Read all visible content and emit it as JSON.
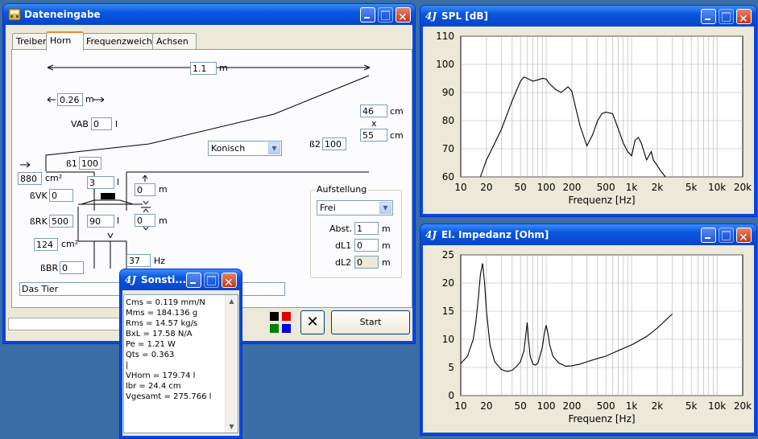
{
  "dateneingabe": {
    "title": "Dateneingabe",
    "tabs": [
      "Treiber",
      "Horn",
      "Frequenzweiche",
      "Achsen"
    ],
    "active_tab": "Horn",
    "fields": {
      "length": "1.1",
      "length_unit": "m",
      "small_len": "0.26",
      "small_len_unit": "m",
      "vab_label": "VAB",
      "vab": "0",
      "vab_unit": "l",
      "width": "46",
      "width_unit": "cm",
      "times": "x",
      "height": "55",
      "height_unit": "cm",
      "beta2_label": "ß2",
      "beta2": "100",
      "beta1_label": "ß1",
      "beta1": "100",
      "flare_type": "Konisch",
      "throat_area": "880",
      "throat_area_unit": "cm²",
      "vol1": "3",
      "vol1_unit": "l",
      "bvk_label": "ßVK",
      "bvk": "0",
      "brk_label": "ßRK",
      "brk": "500",
      "vol2": "90",
      "vol2_unit": "l",
      "dist1": "0",
      "dist1_unit": "m",
      "dist2": "0",
      "dist2_unit": "m",
      "port_area": "124",
      "port_area_unit": "cm²",
      "bbr_label": "ßBR",
      "bbr": "0",
      "freq": "37",
      "freq_unit": "Hz",
      "name": "Das Tier"
    },
    "aufstellung": {
      "label": "Aufstellung",
      "mode": "Frei",
      "abst_label": "Abst.",
      "abst": "1",
      "abst_unit": "m",
      "dl1_label": "dL1",
      "dl1": "0",
      "dl1_unit": "m",
      "dl2_label": "dL2",
      "dl2": "0",
      "dl2_unit": "m"
    },
    "start_label": "Start",
    "swatch_colors": [
      "#000000",
      "#e00000",
      "#008000",
      "#0000e0"
    ]
  },
  "sonstiges": {
    "title": "Sonsti...",
    "lines": [
      "Cms = 0.119 mm/N",
      "Mms = 184.136 g",
      "Rms = 14.57 kg/s",
      "BxL = 17.58 N/A",
      "Pe = 1.21 W",
      "Qts = 0.363",
      "|",
      "VHorn = 179.74 l",
      "lbr = 24.4 cm",
      "Vgesamt = 275.766 l"
    ]
  },
  "chart_data": [
    {
      "type": "line",
      "title": "SPL [dB]",
      "xlabel": "Frequenz [Hz]",
      "ylabel": "",
      "xscale": "log",
      "xlim": [
        10,
        20000
      ],
      "ylim": [
        60,
        110
      ],
      "x_ticks": [
        10,
        20,
        50,
        100,
        200,
        500,
        1000,
        2000,
        5000,
        10000,
        20000
      ],
      "x_tick_labels": [
        "10",
        "20",
        "50",
        "100",
        "200",
        "500",
        "1k",
        "2k",
        "5k",
        "10k",
        "20k"
      ],
      "y_ticks": [
        60,
        70,
        80,
        90,
        100,
        110
      ],
      "grid": true,
      "series": [
        {
          "x": [
            17,
            20,
            25,
            30,
            40,
            50,
            55,
            60,
            70,
            80,
            90,
            100,
            110,
            130,
            150,
            180,
            200,
            220,
            250,
            300,
            350,
            400,
            450,
            500,
            600,
            700,
            800,
            900,
            1000,
            1100,
            1200,
            1300,
            1500,
            1700,
            1800,
            2000,
            2200,
            2500
          ],
          "y": [
            60,
            66,
            72,
            77,
            87,
            94,
            95.5,
            95,
            94,
            94.5,
            95,
            94.8,
            93,
            91,
            90,
            92,
            90.5,
            85,
            78,
            71,
            75,
            80,
            82.5,
            83,
            82.5,
            77,
            72,
            69,
            67.5,
            73,
            74,
            72,
            66,
            69,
            66,
            64,
            62,
            60
          ]
        }
      ]
    },
    {
      "type": "line",
      "title": "El. Impedanz [Ohm]",
      "xlabel": "Frequenz [Hz]",
      "ylabel": "",
      "xscale": "log",
      "xlim": [
        10,
        20000
      ],
      "ylim": [
        0,
        25
      ],
      "x_ticks": [
        10,
        20,
        50,
        100,
        200,
        500,
        1000,
        2000,
        5000,
        10000,
        20000
      ],
      "x_tick_labels": [
        "10",
        "20",
        "50",
        "100",
        "200",
        "500",
        "1k",
        "2k",
        "5k",
        "10k",
        "20k"
      ],
      "y_ticks": [
        0,
        5,
        10,
        15,
        20,
        25
      ],
      "grid": true,
      "series": [
        {
          "x": [
            10,
            12,
            14,
            15,
            16,
            17,
            18,
            19,
            20,
            22,
            25,
            30,
            35,
            40,
            45,
            50,
            55,
            58,
            60,
            62,
            65,
            70,
            75,
            80,
            90,
            95,
            100,
            105,
            110,
            120,
            140,
            170,
            200,
            250,
            300,
            400,
            500,
            700,
            1000,
            1500,
            2000,
            3000
          ],
          "y": [
            5.7,
            7,
            10,
            13,
            17,
            21.5,
            23.5,
            20,
            15,
            9,
            6,
            4.6,
            4.3,
            4.5,
            5.2,
            6,
            8,
            11,
            13,
            10,
            7,
            5.6,
            5.4,
            5.8,
            8.5,
            11,
            12.5,
            11,
            9,
            7,
            5.8,
            5.2,
            5.3,
            5.6,
            6,
            6.6,
            7,
            8,
            9,
            10.5,
            12,
            14.5
          ]
        }
      ]
    }
  ]
}
